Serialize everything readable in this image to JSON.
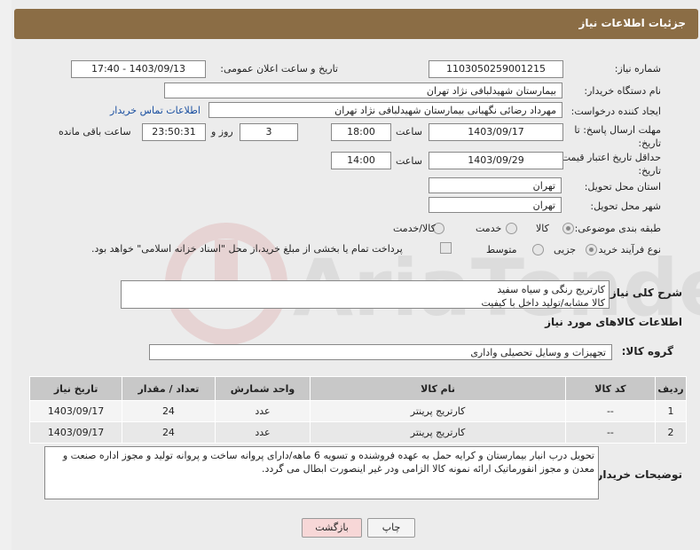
{
  "header": {
    "title": "جزئیات اطلاعات نیاز"
  },
  "fields": {
    "need_number_label": "شماره نیاز:",
    "need_number": "1103050259001215",
    "announce_label": "تاریخ و ساعت اعلان عمومی:",
    "announce_value": "1403/09/13 - 17:40",
    "buyer_org_label": "نام دستگاه خریدار:",
    "buyer_org": "بیمارستان شهیدلبافی نژاد تهران",
    "creator_label": "ایجاد کننده درخواست:",
    "creator": "مهرداد رضائی نگهبانی بیمارستان شهیدلبافی نژاد تهران",
    "contact_link": "اطلاعات تماس خریدار",
    "deadline_label": "مهلت ارسال پاسخ: تا تاریخ:",
    "deadline_date": "1403/09/17",
    "time_label": "ساعت",
    "deadline_time": "18:00",
    "days_value": "3",
    "days_label": "روز و",
    "remaining_time": "23:50:31",
    "remaining_label": "ساعت باقی مانده",
    "validity_label": "حداقل تاریخ اعتبار قیمت: تا تاریخ:",
    "validity_date": "1403/09/29",
    "validity_time_label": "ساعت",
    "validity_time": "14:00",
    "province_label": "استان محل تحویل:",
    "province": "تهران",
    "city_label": "شهر محل تحویل:",
    "city": "تهران",
    "category_label": "طبقه بندی موضوعی:",
    "category_options": [
      "کالا",
      "خدمت",
      "کالا/خدمت"
    ],
    "process_label": "نوع فرآیند خرید :",
    "process_options": [
      "جزیی",
      "متوسط"
    ],
    "payment_note": "پرداخت تمام یا بخشی از مبلغ خرید،از محل \"اسناد خزانه اسلامی\" خواهد بود."
  },
  "description": {
    "label": "شرح کلی نیاز:",
    "line1": "کارتریج رنگی و سیاه سفید",
    "line2": "کالا مشابه/تولید داخل با کیفیت"
  },
  "goods_section": {
    "title": "اطلاعات کالاهای مورد نیاز"
  },
  "goods_group": {
    "label": "گروه کالا:",
    "value": "تجهیزات و وسایل تحصیلی واداری"
  },
  "table": {
    "headers": [
      "ردیف",
      "کد کالا",
      "نام کالا",
      "واحد شمارش",
      "تعداد / مقدار",
      "تاریخ نیاز"
    ],
    "rows": [
      [
        "1",
        "--",
        "کارتریج پرینتر",
        "عدد",
        "24",
        "1403/09/17"
      ],
      [
        "2",
        "--",
        "کارتریج پرینتر",
        "عدد",
        "24",
        "1403/09/17"
      ]
    ]
  },
  "buyer_notes": {
    "label": "توضیحات خریدار:",
    "text": "تحویل درب انبار بیمارستان و کرایه حمل به عهده فروشنده و تسویه 6 ماهه/دارای پروانه ساخت و پروانه تولید و مجوز اداره صنعت و معدن و مجوز انفورماتیک ارائه نمونه کالا الزامی ودر غیر اینصورت ابطال می گردد."
  },
  "buttons": {
    "print": "چاپ",
    "back": "بازگشت"
  },
  "watermark_text": "AriaTender.neT",
  "colors": {
    "header": "#8b6d45",
    "link": "#1a4fa0",
    "back_button": "#f7d7d7"
  }
}
